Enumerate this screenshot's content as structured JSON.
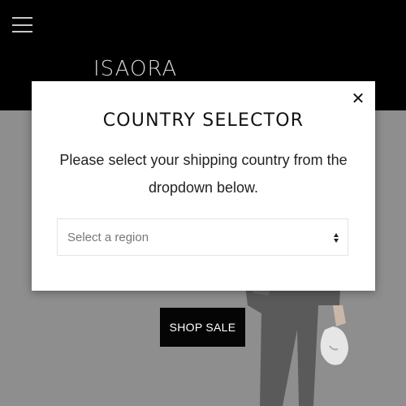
{
  "header": {
    "logo": "ISAORA",
    "menu_icon": "hamburger-menu-icon"
  },
  "hero": {
    "shop_button": "SHOP SALE"
  },
  "modal": {
    "title": "COUNTRY SELECTOR",
    "description": "Please select your shipping country from the dropdown below.",
    "select_placeholder": "Select a region",
    "close_icon": "close-icon"
  },
  "colors": {
    "header_bg": "#000000",
    "hero_bg": "#8e8e8e",
    "button_bg": "#050505"
  }
}
